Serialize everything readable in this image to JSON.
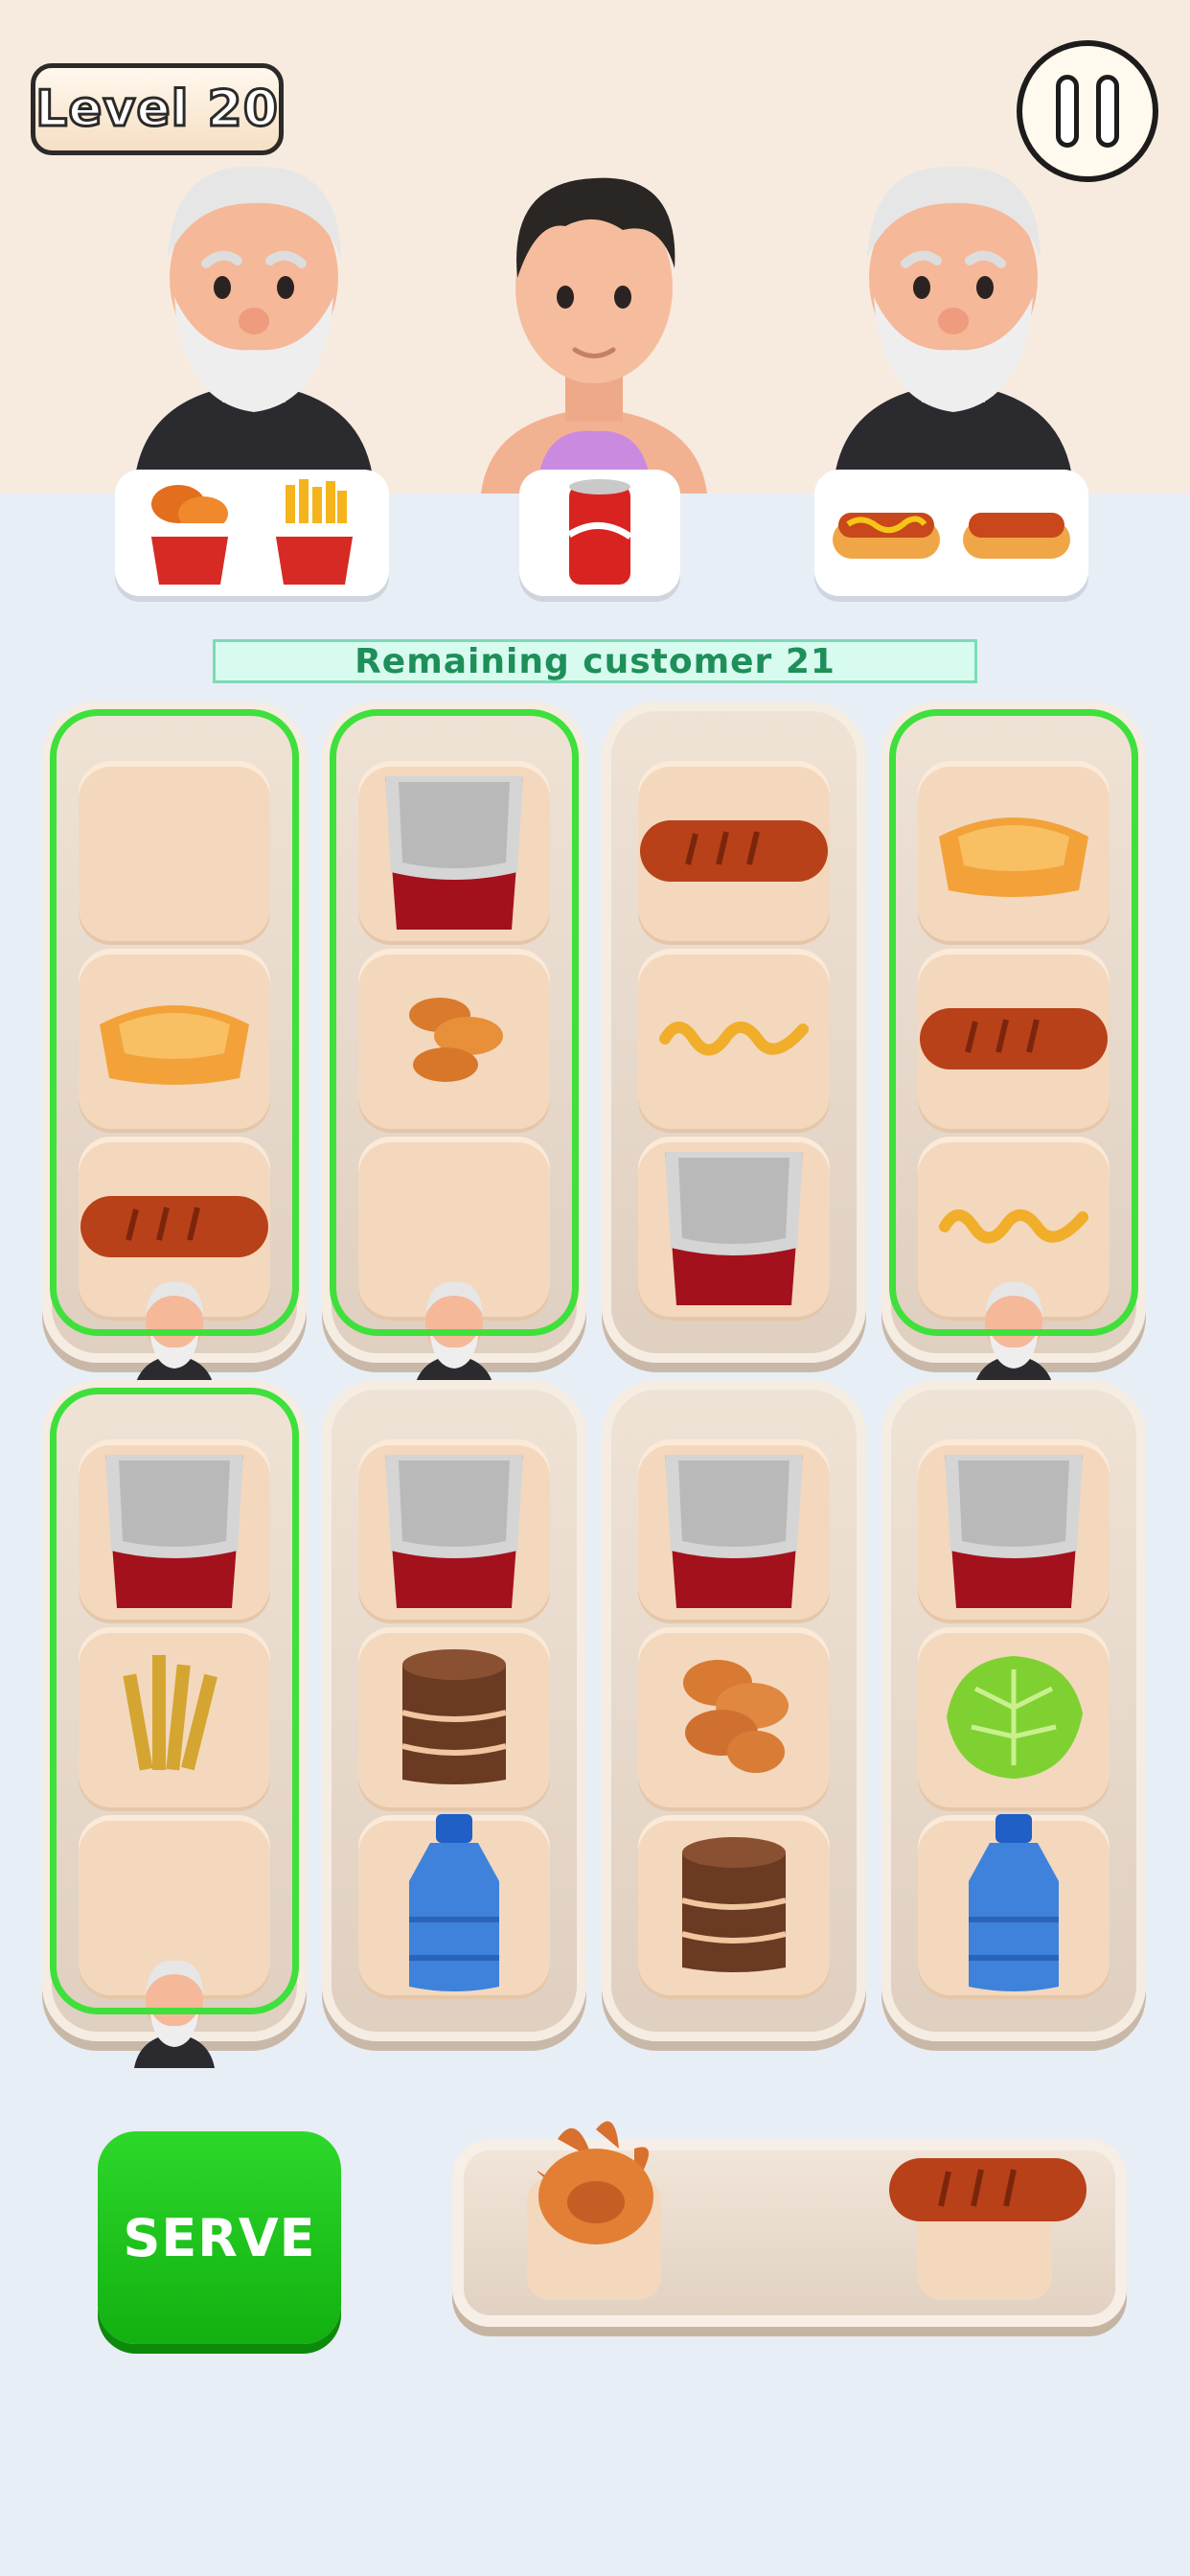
{
  "hud": {
    "level_label": "Level 20",
    "pause_icon": "pause-icon"
  },
  "status": {
    "remaining_label": "Remaining customer 21"
  },
  "customers": [
    {
      "type": "old-man",
      "order": [
        "fried-chicken-bucket",
        "fries-bucket"
      ]
    },
    {
      "type": "young-man",
      "order": [
        "soda-can"
      ]
    },
    {
      "type": "old-man",
      "order": [
        "hotdog",
        "hotdog"
      ]
    }
  ],
  "trays": [
    {
      "highlighted": true,
      "customer": "old-man",
      "items": [
        "empty",
        "hotdog-bun",
        "sausage"
      ]
    },
    {
      "highlighted": true,
      "customer": "old-man",
      "items": [
        "empty-cup",
        "chicken-wings",
        "empty"
      ]
    },
    {
      "highlighted": false,
      "customer": null,
      "items": [
        "sausage",
        "mustard",
        "empty-cup"
      ]
    },
    {
      "highlighted": true,
      "customer": "old-man",
      "items": [
        "hotdog-bun",
        "sausage",
        "mustard"
      ]
    },
    {
      "highlighted": true,
      "customer": "old-man",
      "items": [
        "empty-cup",
        "fries",
        "empty"
      ]
    },
    {
      "highlighted": false,
      "customer": null,
      "items": [
        "empty-cup",
        "chocolate-cake",
        "water-bottle"
      ]
    },
    {
      "highlighted": false,
      "customer": null,
      "items": [
        "empty-cup",
        "nuggets",
        "chocolate-cake"
      ]
    },
    {
      "highlighted": false,
      "customer": null,
      "items": [
        "empty-cup",
        "lettuce",
        "water-bottle"
      ]
    }
  ],
  "holding_tray": {
    "items": [
      "onion-blossom",
      "sausage"
    ]
  },
  "actions": {
    "serve_label": "SERVE"
  },
  "colors": {
    "highlight": "#3fe03b",
    "serve": "#1ec81b",
    "remaining_text": "#1e8f59"
  }
}
